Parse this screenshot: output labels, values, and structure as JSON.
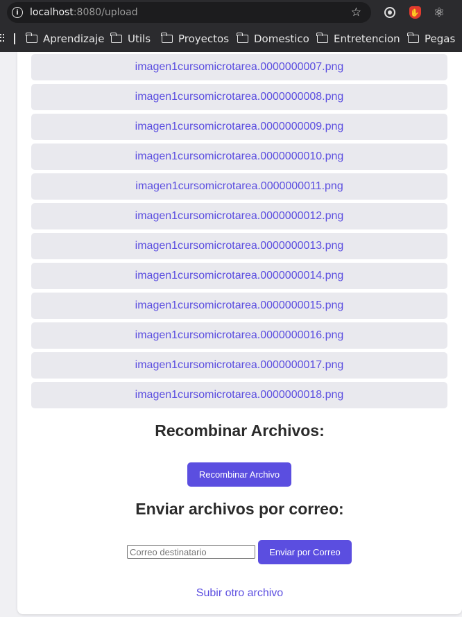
{
  "browser": {
    "url_host": "localhost",
    "url_rest": ":8080/upload",
    "icons": [
      "info-icon",
      "star-icon",
      "target-extension-icon",
      "stop-extension-icon",
      "react-extension-icon"
    ],
    "bookmarks": [
      {
        "label": "Aprendizaje"
      },
      {
        "label": "Utils"
      },
      {
        "label": "Proyectos"
      },
      {
        "label": "Domestico"
      },
      {
        "label": "Entretencion"
      },
      {
        "label": "Pegas"
      }
    ]
  },
  "files": [
    {
      "name": "imagen1cursomicrotarea.0000000007.png"
    },
    {
      "name": "imagen1cursomicrotarea.0000000008.png"
    },
    {
      "name": "imagen1cursomicrotarea.0000000009.png"
    },
    {
      "name": "imagen1cursomicrotarea.0000000010.png"
    },
    {
      "name": "imagen1cursomicrotarea.0000000011.png"
    },
    {
      "name": "imagen1cursomicrotarea.0000000012.png"
    },
    {
      "name": "imagen1cursomicrotarea.0000000013.png"
    },
    {
      "name": "imagen1cursomicrotarea.0000000014.png"
    },
    {
      "name": "imagen1cursomicrotarea.0000000015.png"
    },
    {
      "name": "imagen1cursomicrotarea.0000000016.png"
    },
    {
      "name": "imagen1cursomicrotarea.0000000017.png"
    },
    {
      "name": "imagen1cursomicrotarea.0000000018.png"
    }
  ],
  "recombine": {
    "title": "Recombinar Archivos:",
    "button_label": "Recombinar Archivo"
  },
  "email": {
    "title": "Enviar archivos por correo:",
    "input_placeholder": "Correo destinatario",
    "input_value": "",
    "button_label": "Enviar por Correo"
  },
  "upload_link": "Subir otro archivo",
  "colors": {
    "accent": "#5b4ee0",
    "file_item_bg": "#e9e9ee",
    "browser_chrome": "#2b2b2e"
  }
}
